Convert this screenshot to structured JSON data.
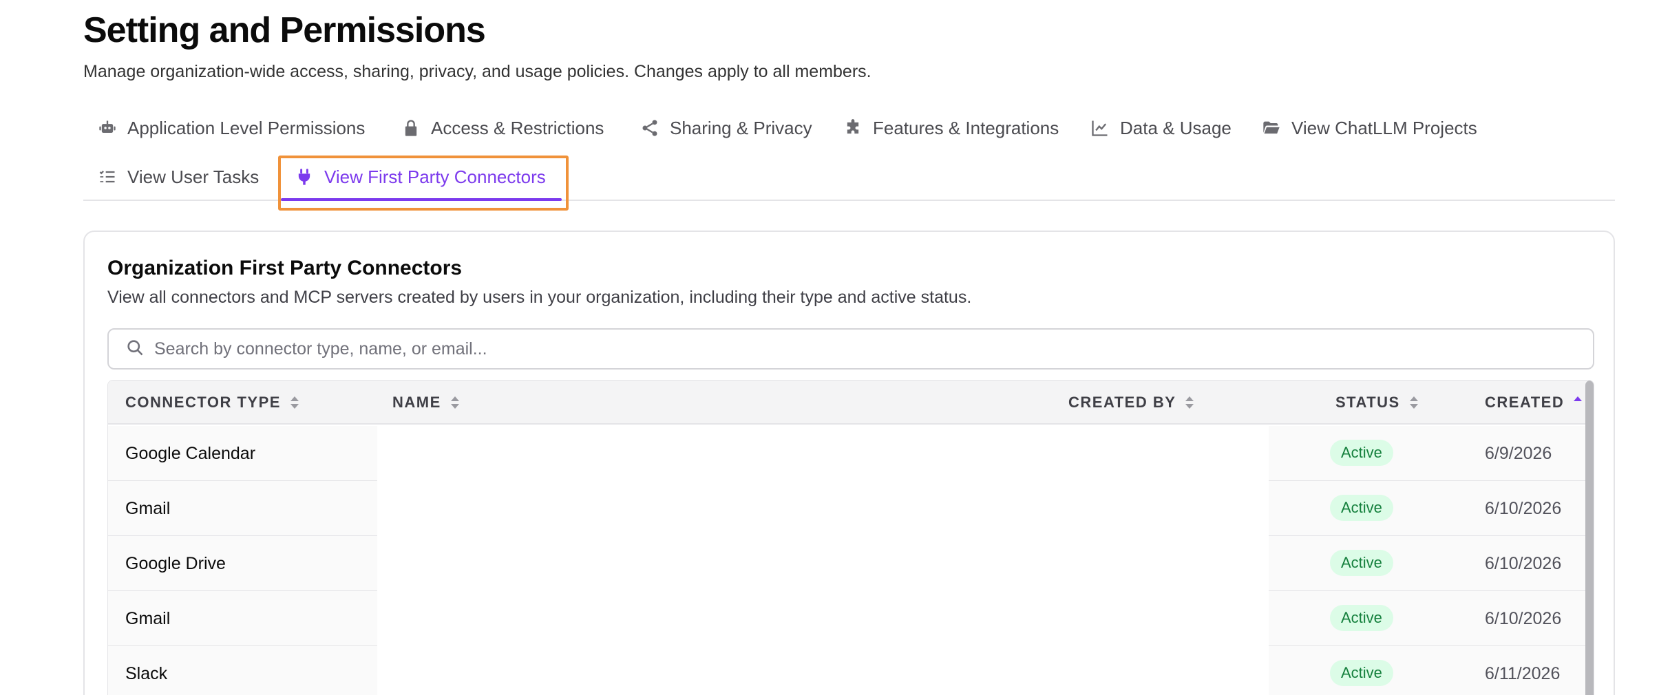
{
  "header": {
    "title": "Setting and Permissions",
    "subtitle": "Manage organization-wide access, sharing, privacy, and usage policies. Changes apply to all members."
  },
  "tabs": [
    {
      "label": "Application Level Permissions",
      "icon": "robot-icon",
      "active": false
    },
    {
      "label": "Access & Restrictions",
      "icon": "lock-icon",
      "active": false
    },
    {
      "label": "Sharing & Privacy",
      "icon": "share-icon",
      "active": false
    },
    {
      "label": "Features & Integrations",
      "icon": "puzzle-icon",
      "active": false
    },
    {
      "label": "Data & Usage",
      "icon": "chart-line-icon",
      "active": false
    },
    {
      "label": "View ChatLLM Projects",
      "icon": "folder-open-icon",
      "active": false
    },
    {
      "label": "View User Tasks",
      "icon": "task-list-icon",
      "active": false
    },
    {
      "label": "View First Party Connectors",
      "icon": "plug-icon",
      "active": true
    }
  ],
  "colors": {
    "accent": "#7c3aed",
    "highlight": "#f0923a",
    "active_badge_bg": "#dcfce7",
    "active_badge_text": "#15803d"
  },
  "card": {
    "title": "Organization First Party Connectors",
    "description": "View all connectors and MCP servers created by users in your organization, including their type and active status."
  },
  "search": {
    "placeholder": "Search by connector type, name, or email...",
    "value": ""
  },
  "table": {
    "columns": [
      "CONNECTOR TYPE",
      "NAME",
      "CREATED BY",
      "STATUS",
      "CREATED"
    ],
    "sorted_column": "CREATED",
    "rows": [
      {
        "type": "Google Calendar",
        "status": "Active",
        "created": "6/9/2026"
      },
      {
        "type": "Gmail",
        "status": "Active",
        "created": "6/10/2026"
      },
      {
        "type": "Google Drive",
        "status": "Active",
        "created": "6/10/2026"
      },
      {
        "type": "Gmail",
        "status": "Active",
        "created": "6/10/2026"
      },
      {
        "type": "Slack",
        "status": "Active",
        "created": "6/11/2026"
      }
    ]
  }
}
